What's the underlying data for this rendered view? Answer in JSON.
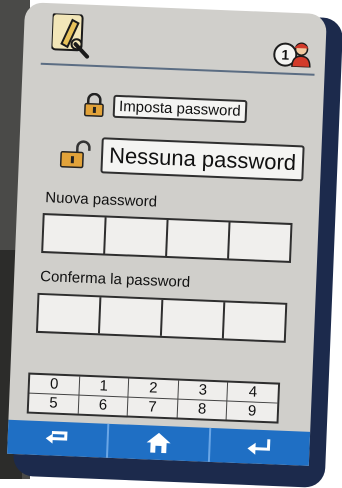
{
  "security": {
    "set_password_label": "Imposta password",
    "no_password_label": "Nessuna password",
    "new_password_label": "Nuova password",
    "confirm_password_label": "Conferma la password"
  },
  "user": {
    "number": "1"
  },
  "keypad": {
    "keys": [
      "0",
      "1",
      "2",
      "3",
      "4",
      "5",
      "6",
      "7",
      "8",
      "9"
    ]
  },
  "nav": {
    "back_icon": "back-arrow-icon",
    "home_icon": "home-icon",
    "enter_icon": "enter-icon"
  },
  "colors": {
    "screen_bg": "#d0cfcb",
    "accent_bar": "#1f6fc4",
    "lock_gold": "#e2a33a"
  }
}
